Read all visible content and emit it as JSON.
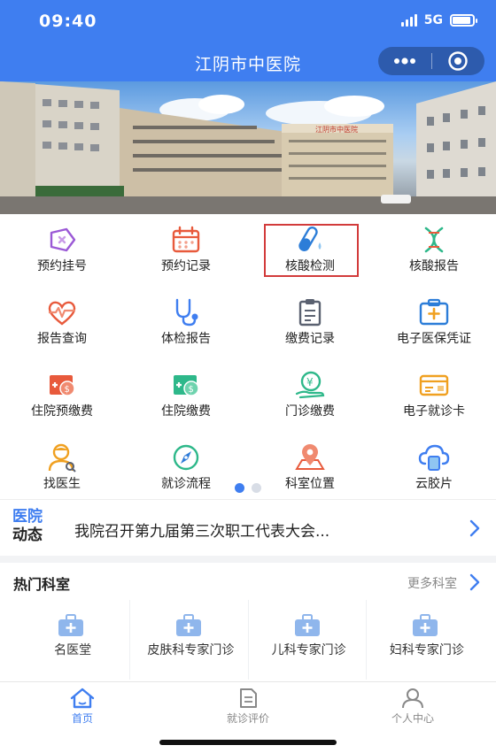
{
  "status_bar": {
    "time": "09:40",
    "network": "5G"
  },
  "header": {
    "title": "江阴市中医院",
    "more_icon": "ellipsis-icon",
    "close_icon": "target-icon"
  },
  "banner": {
    "sign_text": "江阴市中医院"
  },
  "menu": {
    "items": [
      {
        "label": "预约挂号",
        "icon": "ticket-icon",
        "color": "#9b59d6"
      },
      {
        "label": "预约记录",
        "icon": "calendar-icon",
        "color": "#e85a3c"
      },
      {
        "label": "核酸检测",
        "icon": "test-tube-icon",
        "color": "#2c7dd8"
      },
      {
        "label": "核酸报告",
        "icon": "dna-icon",
        "color": "#2eb88a"
      },
      {
        "label": "报告查询",
        "icon": "heart-pulse-icon",
        "color": "#e85a3c"
      },
      {
        "label": "体检报告",
        "icon": "stethoscope-icon",
        "color": "#3f7ef0"
      },
      {
        "label": "缴费记录",
        "icon": "clipboard-icon",
        "color": "#5a6170"
      },
      {
        "label": "电子医保凭证",
        "icon": "medical-card-icon",
        "color": "#2c7dd8"
      },
      {
        "label": "住院预缴费",
        "icon": "money-bill-icon",
        "color": "#e85a3c"
      },
      {
        "label": "住院缴费",
        "icon": "money-bill-icon",
        "color": "#2eb88a"
      },
      {
        "label": "门诊缴费",
        "icon": "yen-hand-icon",
        "color": "#2eb88a"
      },
      {
        "label": "电子就诊卡",
        "icon": "id-card-icon",
        "color": "#f0a020"
      },
      {
        "label": "找医生",
        "icon": "doctor-icon",
        "color": "#f0a020"
      },
      {
        "label": "就诊流程",
        "icon": "compass-icon",
        "color": "#2eb88a"
      },
      {
        "label": "科室位置",
        "icon": "map-pin-icon",
        "color": "#e85a3c"
      },
      {
        "label": "云胶片",
        "icon": "cloud-film-icon",
        "color": "#3f7ef0"
      }
    ],
    "highlighted_item": "核酸检测",
    "page_dots": {
      "count": 2,
      "active": 1
    }
  },
  "news": {
    "tag_line1": "医院",
    "tag_line2": "动态",
    "headline": "我院召开第九届第三次职工代表大会..."
  },
  "hot_departments": {
    "title": "热门科室",
    "more_label": "更多科室",
    "items": [
      {
        "label": "名医堂"
      },
      {
        "label": "皮肤科专家门诊"
      },
      {
        "label": "儿科专家门诊"
      },
      {
        "label": "妇科专家门诊"
      }
    ]
  },
  "tabbar": {
    "tabs": [
      {
        "label": "首页",
        "icon": "home-icon",
        "active": true
      },
      {
        "label": "就诊评价",
        "icon": "document-icon",
        "active": false
      },
      {
        "label": "个人中心",
        "icon": "user-icon",
        "active": false
      }
    ]
  },
  "colors": {
    "accent": "#3f7ef0",
    "highlight_border": "#d23b3b"
  }
}
